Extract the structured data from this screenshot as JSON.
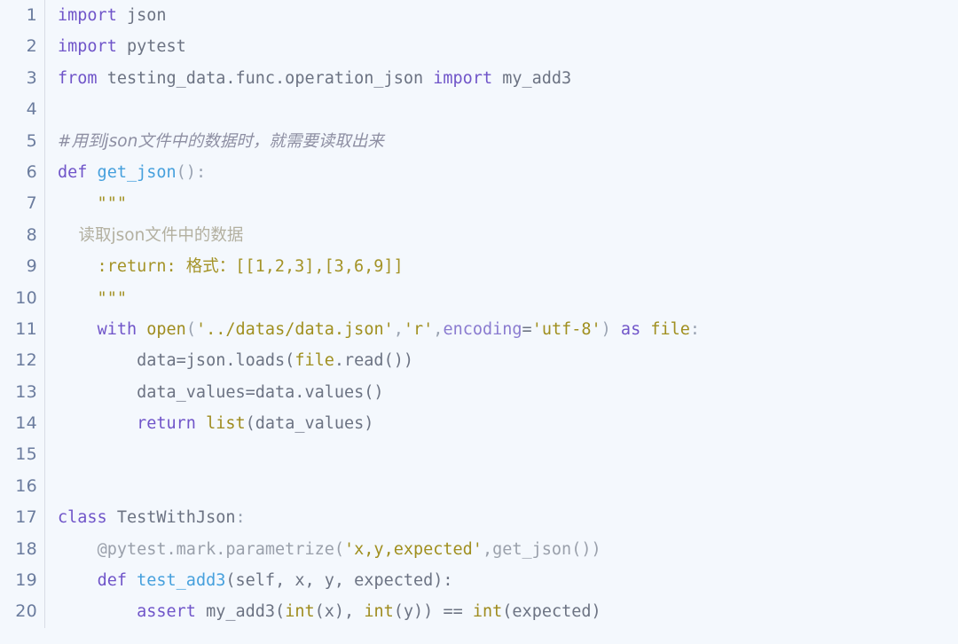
{
  "editor": {
    "language": "Python",
    "background_color": "#f4f8fd",
    "gutter_color": "#6b7c9e",
    "divider_color": "#d8dde6",
    "first_line": 1,
    "last_line": 20,
    "total_lines": 20
  },
  "theme": {
    "keyword": "#7055c9",
    "function_name": "#46a0dd",
    "builtin": "#9f8c1f",
    "string": "#a08f1f",
    "docstring": "#a49327",
    "comment": "#8e8fa3",
    "plain": "#6c7383",
    "decorator": "#9aa0ab",
    "parameter": "#8a7bd0"
  },
  "line_numbers": [
    "1",
    "2",
    "3",
    "4",
    "5",
    "6",
    "7",
    "8",
    "9",
    "10",
    "11",
    "12",
    "13",
    "14",
    "15",
    "16",
    "17",
    "18",
    "19",
    "20"
  ],
  "code": {
    "l1": {
      "kw": "import",
      "rest": " json"
    },
    "l2": {
      "kw": "import",
      "rest": " pytest"
    },
    "l3": {
      "kw": "from",
      "module": " testing_data.func.operation_json ",
      "kw2": "import",
      "name": " my_add3"
    },
    "l4": {
      "text": ""
    },
    "l5": {
      "comment": "#用到json文件中的数据时，就需要读取出来"
    },
    "l6": {
      "kw": "def",
      "name": " get_json",
      "punct": "():"
    },
    "l7": {
      "doc": "    \"\"\""
    },
    "l8": {
      "doc": "    读取json文件中的数据"
    },
    "l9": {
      "doc": "    :return: 格式：[[1,2,3],[3,6,9]]"
    },
    "l10": {
      "doc": "    \"\"\""
    },
    "l11": {
      "indent": "    ",
      "kw": "with",
      "fn": " open",
      "p1": "(",
      "str1": "'../datas/data.json'",
      "c1": ",",
      "str2": "'r'",
      "c2": ",",
      "param": "encoding",
      "eq": "=",
      "str3": "'utf-8'",
      "p2": ")",
      "kw2": " as ",
      "var": "file",
      "colon": ":"
    },
    "l12": {
      "text": "        data=json.loads(",
      "var": "file",
      "tail": ".read())"
    },
    "l13": {
      "text": "        data_values=data.values()"
    },
    "l14": {
      "indent": "        ",
      "kw": "return",
      "fn": " list",
      "tail": "(data_values)"
    },
    "l15": {
      "text": ""
    },
    "l16": {
      "text": ""
    },
    "l17": {
      "kw": "class",
      "name": " TestWithJson",
      "punct": ":"
    },
    "l18": {
      "indent": "    ",
      "deco": "@pytest.mark.parametrize(",
      "str": "'x,y,expected'",
      "tail": ",get_json())"
    },
    "l19": {
      "indent": "    ",
      "kw": "def",
      "name": " test_add3",
      "tail": "(self, x, y, expected):"
    },
    "l20": {
      "indent": "        ",
      "kw": "assert",
      "call": " my_add3(",
      "b1": "int",
      "a1": "(x), ",
      "b2": "int",
      "a2": "(y)) ",
      "op": "== ",
      "b3": "int",
      "a3": "(expected)"
    }
  }
}
